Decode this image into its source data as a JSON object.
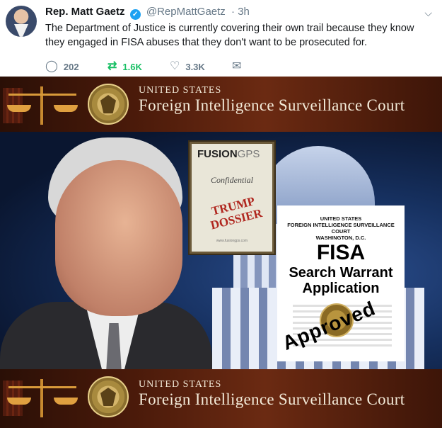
{
  "tweet": {
    "name": "Rep. Matt Gaetz",
    "handle": "@RepMattGaetz",
    "time": "· 3h",
    "text": "The Department of Justice is currently covering their own trail because they know they engaged in FISA abuses that they don't want to be prosecuted for.",
    "replies": "202",
    "retweets": "1.6K",
    "likes": "3.3K"
  },
  "banner": {
    "line1": "UNITED STATES",
    "line2": "Foreign Intelligence Surveillance Court"
  },
  "dossier": {
    "logo_a": "FUSION",
    "logo_b": "GPS",
    "confidential": "Confidential",
    "stamp_line1": "TRUMP",
    "stamp_line2": "DOSSIER",
    "footer": "www.fusiongps.com"
  },
  "warrant": {
    "header_l1": "UNITED STATES",
    "header_l2": "FOREIGN INTELLIGENCE SURVEILLANCE COURT",
    "header_l3": "WASHINGTON, D.C.",
    "title": "FISA",
    "sub_l1": "Search Warrant",
    "sub_l2": "Application",
    "approved": "Approved"
  },
  "colors": {
    "retweet_green": "#17bf63",
    "verified_blue": "#1da1f2",
    "stamp_red": "#b0261e"
  },
  "icons": [
    "reply-icon",
    "retweet-icon",
    "like-icon",
    "message-icon",
    "chevron-down-icon",
    "verified-badge-icon"
  ]
}
